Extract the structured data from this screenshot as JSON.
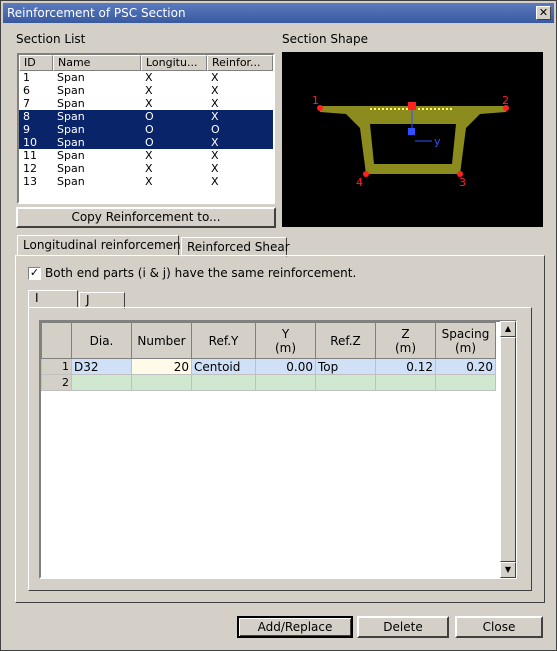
{
  "window": {
    "title": "Reinforcement of PSC Section",
    "close_glyph": "✕"
  },
  "section_list": {
    "label": "Section List",
    "columns": [
      "ID",
      "Name",
      "Longitu...",
      "Reinfor..."
    ],
    "rows": [
      {
        "id": "1",
        "name": "Span",
        "long": "X",
        "reinf": "X",
        "selected": false
      },
      {
        "id": "6",
        "name": "Span",
        "long": "X",
        "reinf": "X",
        "selected": false
      },
      {
        "id": "7",
        "name": "Span",
        "long": "X",
        "reinf": "X",
        "selected": false
      },
      {
        "id": "8",
        "name": "Span",
        "long": "O",
        "reinf": "X",
        "selected": true
      },
      {
        "id": "9",
        "name": "Span",
        "long": "O",
        "reinf": "O",
        "selected": true
      },
      {
        "id": "10",
        "name": "Span",
        "long": "O",
        "reinf": "X",
        "selected": true
      },
      {
        "id": "11",
        "name": "Span",
        "long": "X",
        "reinf": "X",
        "selected": false
      },
      {
        "id": "12",
        "name": "Span",
        "long": "X",
        "reinf": "X",
        "selected": false
      },
      {
        "id": "13",
        "name": "Span",
        "long": "X",
        "reinf": "X",
        "selected": false
      }
    ],
    "copy_button": "Copy Reinforcement to..."
  },
  "section_shape": {
    "label": "Section Shape",
    "points": [
      "1",
      "2",
      "3",
      "4"
    ],
    "axis_y": "y"
  },
  "tabs": [
    "Longitudinal reinforcement",
    "Reinforced Shear"
  ],
  "same_reinforcement": {
    "checked": true,
    "label": "Both end parts (i & j) have the same reinforcement."
  },
  "subtabs": [
    "I",
    "J"
  ],
  "grid": {
    "headers": [
      "Dia.",
      "Number",
      "Ref.Y",
      "Y\n(m)",
      "Ref.Z",
      "Z\n(m)",
      "Spacing\n(m)"
    ],
    "rows": [
      {
        "n": "1",
        "dia": "D32",
        "number": "20",
        "refy": "Centoid",
        "y": "0.00",
        "refz": "Top",
        "z": "0.12",
        "spacing": "0.20"
      },
      {
        "n": "2",
        "dia": "",
        "number": "",
        "refy": "",
        "y": "",
        "refz": "",
        "z": "",
        "spacing": ""
      }
    ]
  },
  "buttons": {
    "add": "Add/Replace",
    "delete": "Delete",
    "close": "Close"
  },
  "colors": {
    "shape_fill": "#8b8b1e",
    "marker": "#ff2020",
    "axis": "#3050ff"
  }
}
